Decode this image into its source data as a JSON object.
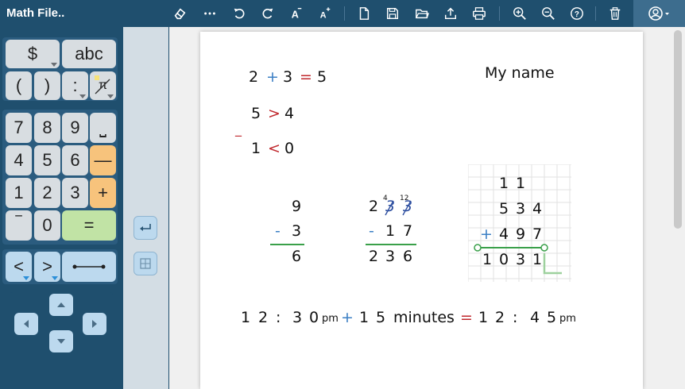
{
  "app": {
    "title": "Math File.."
  },
  "toolbar": {
    "icons": [
      "eraser-icon",
      "more-icon",
      "undo-icon",
      "redo-icon",
      "font-decrease-icon",
      "font-increase-icon",
      "new-file-icon",
      "save-icon",
      "open-folder-icon",
      "export-icon",
      "print-icon",
      "zoom-in-icon",
      "zoom-out-icon",
      "help-icon",
      "trash-icon",
      "account-icon"
    ]
  },
  "keypad": {
    "dollar": "$",
    "abc": "abc",
    "lparen": "(",
    "rparen": ")",
    "colon": ":",
    "pi": "π",
    "seven": "7",
    "eight": "8",
    "nine": "9",
    "space": "⎵",
    "four": "4",
    "five": "5",
    "six": "6",
    "minus": "—",
    "one": "1",
    "two": "2",
    "three": "3",
    "plus": "+",
    "neg": "‾",
    "zero": "0",
    "equals": "=",
    "lt": "<",
    "gt": ">"
  },
  "doc": {
    "eq1": {
      "a": "2",
      "op": "+",
      "b": "3",
      "eq": "=",
      "c": "5"
    },
    "eq2": {
      "a": "5",
      "op": ">",
      "b": "4"
    },
    "eq3": {
      "neg": "‾",
      "a": "1",
      "op": "<",
      "b": "0"
    },
    "name": "My name",
    "sub1": {
      "top": "9",
      "op": "-",
      "bottom": "3",
      "result": "6"
    },
    "sub2": {
      "top_d1": "2",
      "top_d2": "3",
      "top_d3": "3",
      "borrow1": "4",
      "borrow2": "12",
      "op": "-",
      "bot_d1": "1",
      "bot_d2": "7",
      "res_d1": "2",
      "res_d2": "3",
      "res_d3": "6"
    },
    "add": {
      "carry_d1": "1",
      "carry_d2": "1",
      "a_d1": "5",
      "a_d2": "3",
      "a_d3": "4",
      "op": "+",
      "b_d1": "4",
      "b_d2": "9",
      "b_d3": "7",
      "r_d1": "1",
      "r_d2": "0",
      "r_d3": "3",
      "r_d4": "1"
    },
    "time": {
      "h1": "1",
      "h2": "2",
      "c1": ":",
      "m1": "3",
      "m2": "0",
      "ap1": "pm",
      "op": "+",
      "d1": "1",
      "d2": "5",
      "unit": "minutes",
      "eq": "=",
      "r_h1": "1",
      "r_h2": "2",
      "c2": ":",
      "r_m1": "4",
      "r_m2": "5",
      "ap2": "pm"
    }
  },
  "colors": {
    "accent": "#1f4f6e",
    "orange_key": "#f7c37c",
    "green_key": "#c1e3a5",
    "blue_key": "#bcd9ee",
    "op_blue": "#3b7fc4",
    "op_red": "#c0282d"
  }
}
